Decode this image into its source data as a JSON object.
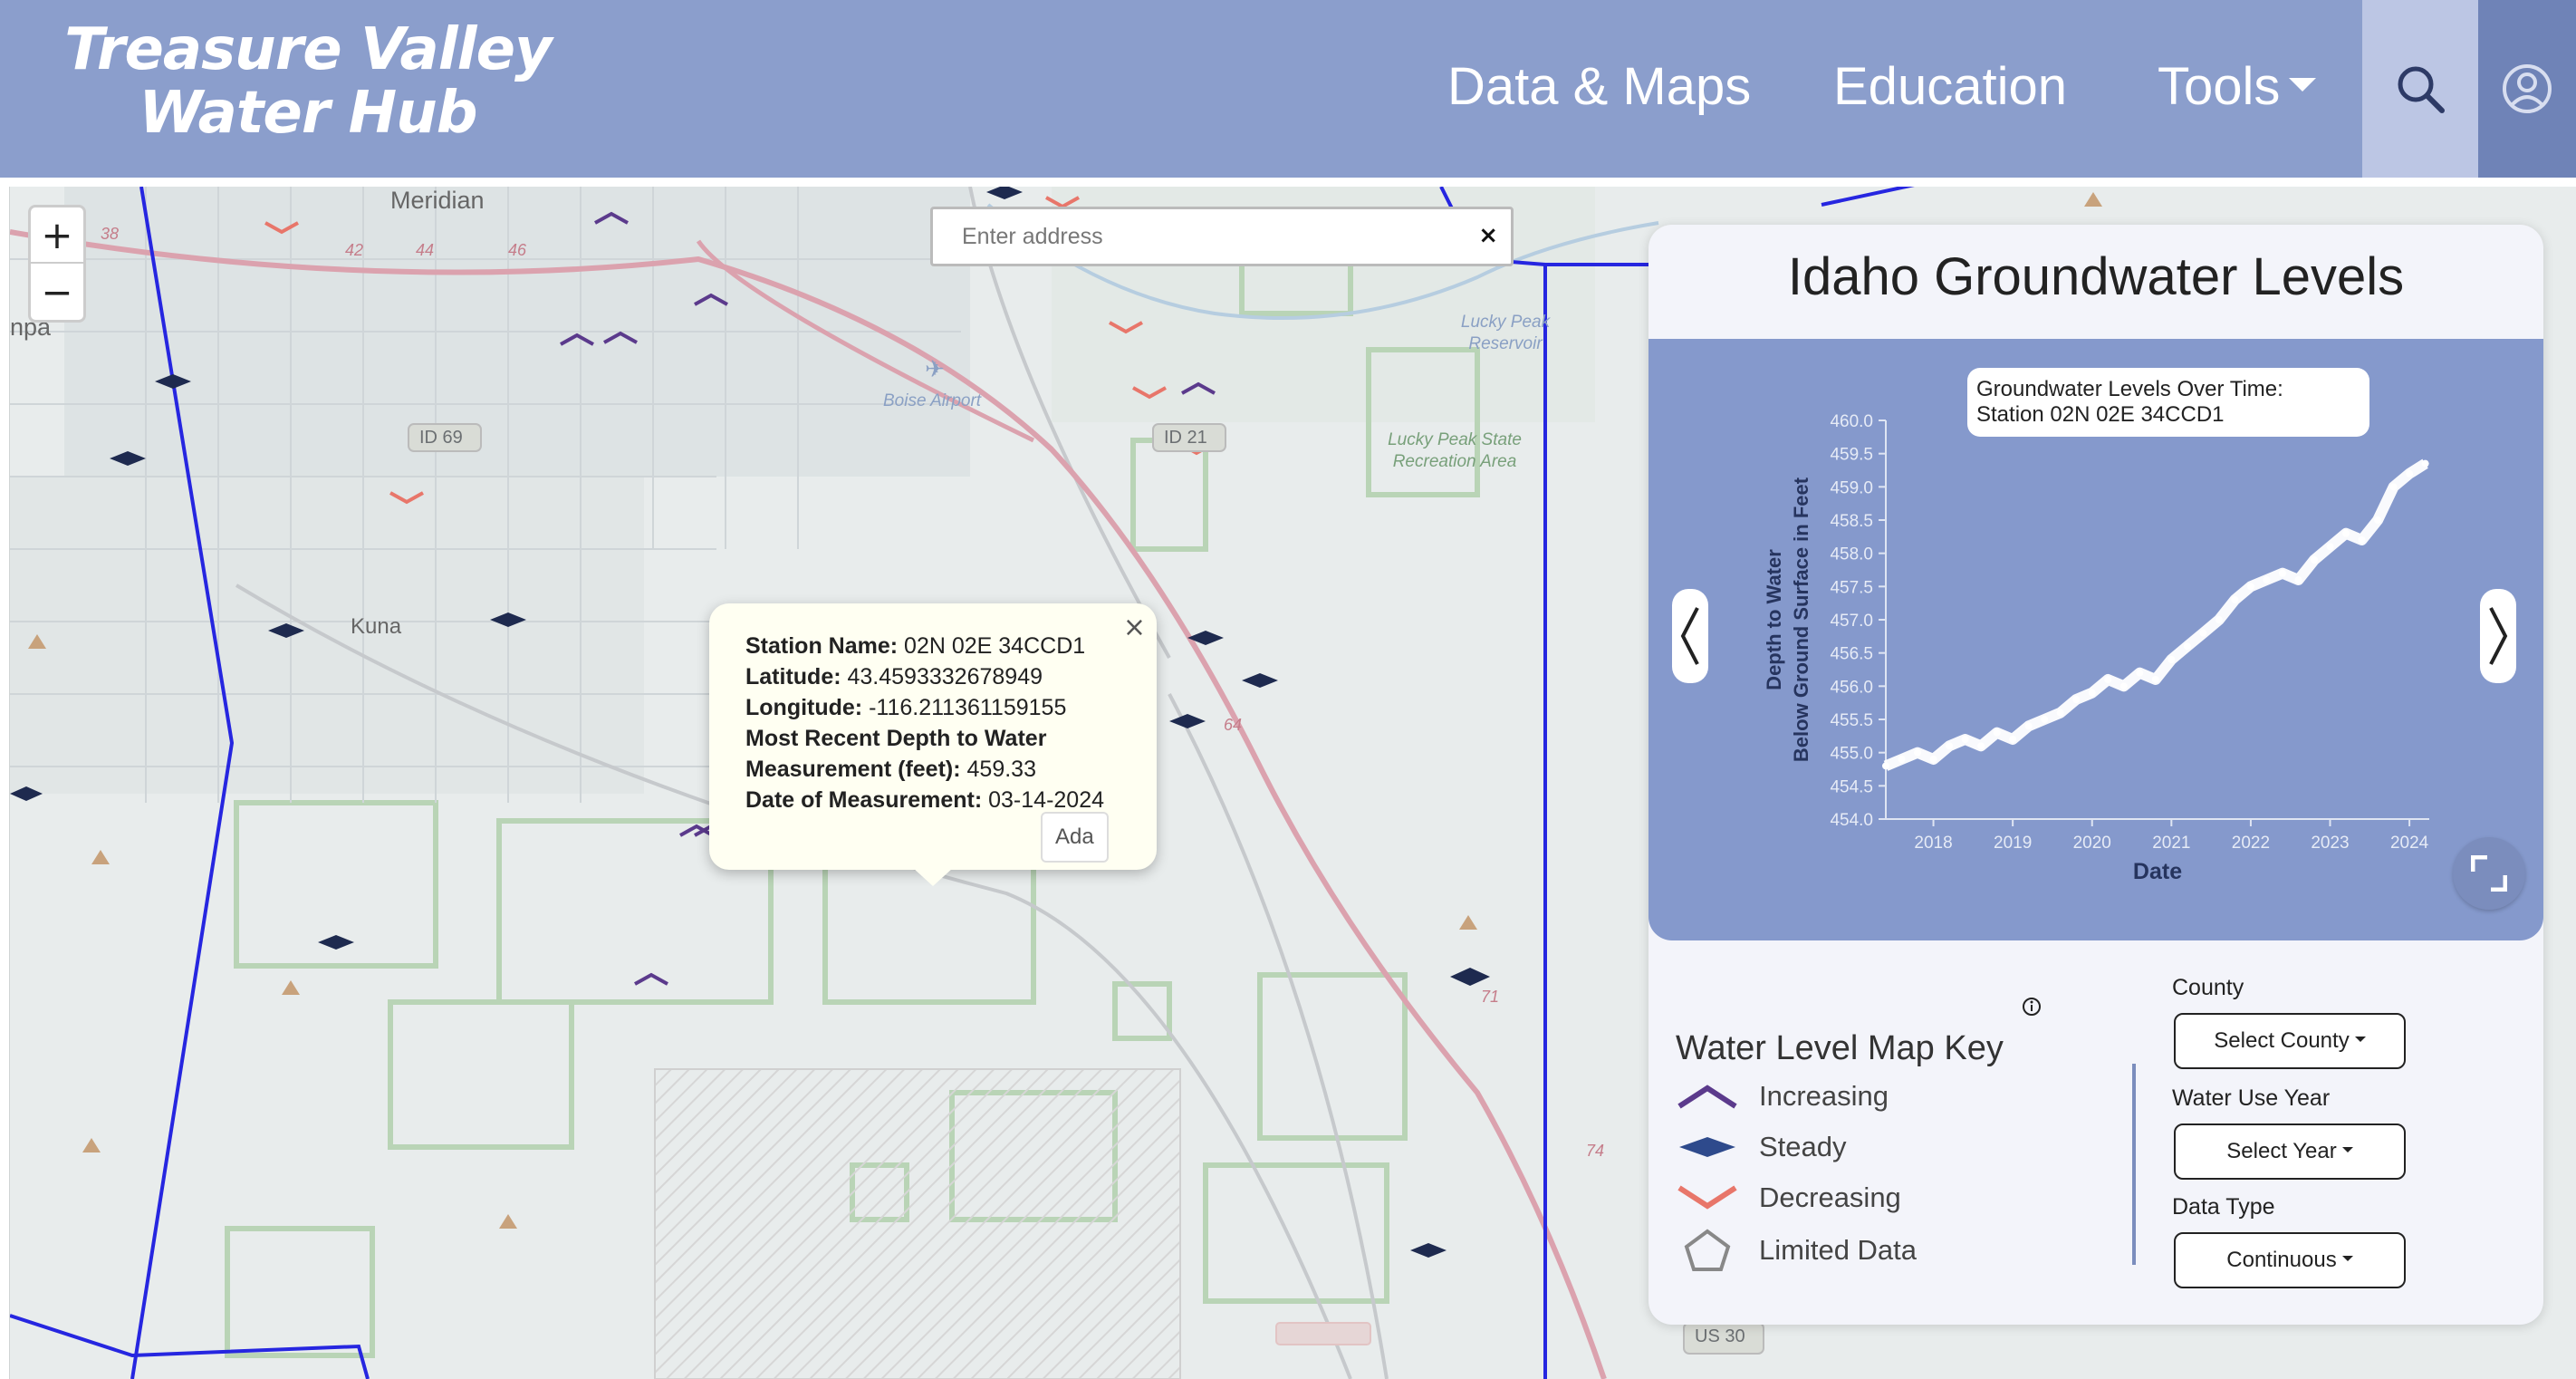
{
  "header": {
    "logo_line1": "Treasure Valley",
    "logo_line2": "Water Hub",
    "nav": [
      {
        "label": "Data & Maps"
      },
      {
        "label": "Education"
      },
      {
        "label": "Tools"
      }
    ],
    "bg_color": "#8b9ecc"
  },
  "map": {
    "zoom_in": "+",
    "zoom_out": "−",
    "address_placeholder": "Enter address",
    "address_clear": "×",
    "labels": {
      "meridian": "Meridian",
      "kuna": "Kuna",
      "npa": "npa",
      "boise_airport": "Boise Airport",
      "lucky_peak_reservoir": "Lucky Peak Reservoir",
      "lucky_peak_area": "Lucky Peak State Recreation Area",
      "id69": "ID 69",
      "id21": "ID 21",
      "us30": "US 30",
      "exit38": "38",
      "exit42": "42",
      "exit44": "44",
      "exit46": "46",
      "rt64": "64",
      "rt71": "71",
      "rt74": "74"
    },
    "popup": {
      "station_label": "Station Name:",
      "station_value": "02N 02E 34CCD1",
      "lat_label": "Latitude:",
      "lat_value": "43.4593332678949",
      "lon_label": "Longitude:",
      "lon_value": "-116.211361159155",
      "depth_label": "Most Recent Depth to Water Measurement (feet):",
      "depth_value": "459.33",
      "date_label": "Date of Measurement:",
      "date_value": "03-14-2024",
      "close": "×"
    },
    "county_label": "Ada"
  },
  "panel": {
    "title": "Idaho Groundwater Levels",
    "chart_title_line1": "Groundwater Levels Over Time:",
    "chart_title_line2": "Station 02N 02E 34CCD1",
    "key": {
      "title": "Water Level Map Key",
      "items": [
        {
          "label": "Increasing",
          "icon": "increasing-chevron-icon",
          "color": "#5b3a8c"
        },
        {
          "label": "Steady",
          "icon": "steady-diamond-icon",
          "color": "#2e4a8c"
        },
        {
          "label": "Decreasing",
          "icon": "decreasing-chevron-icon",
          "color": "#e8766a"
        },
        {
          "label": "Limited Data",
          "icon": "pentagon-icon",
          "color": "#888888"
        }
      ]
    },
    "filters": {
      "county_label": "County",
      "county_button": "Select County",
      "year_label": "Water Use Year",
      "year_button": "Select Year",
      "type_label": "Data Type",
      "type_button": "Continuous"
    }
  },
  "chart_data": {
    "type": "line",
    "title": "Groundwater Levels Over Time: Station 02N 02E 34CCD1",
    "xlabel": "Date",
    "ylabel": "Depth to Water Below Ground Surface in Feet",
    "x_ticks": [
      "2018",
      "2019",
      "2020",
      "2021",
      "2022",
      "2023",
      "2024"
    ],
    "y_ticks": [
      "454.0",
      "454.5",
      "455.0",
      "455.5",
      "456.0",
      "456.5",
      "457.0",
      "457.5",
      "458.0",
      "458.5",
      "459.0",
      "459.5",
      "460.0"
    ],
    "ylim": [
      454.0,
      460.0
    ],
    "xlim": [
      2017.4,
      2024.25
    ],
    "line_color": "#ffffff",
    "x": [
      2017.4,
      2017.6,
      2017.8,
      2018.0,
      2018.2,
      2018.4,
      2018.6,
      2018.8,
      2019.0,
      2019.2,
      2019.4,
      2019.6,
      2019.8,
      2020.0,
      2020.2,
      2020.4,
      2020.6,
      2020.8,
      2021.0,
      2021.2,
      2021.4,
      2021.6,
      2021.8,
      2022.0,
      2022.2,
      2022.4,
      2022.6,
      2022.8,
      2023.0,
      2023.2,
      2023.4,
      2023.6,
      2023.8,
      2024.0,
      2024.2
    ],
    "y": [
      454.8,
      454.9,
      455.0,
      454.9,
      455.1,
      455.2,
      455.1,
      455.3,
      455.2,
      455.4,
      455.5,
      455.6,
      455.8,
      455.9,
      456.1,
      456.0,
      456.2,
      456.1,
      456.4,
      456.6,
      456.8,
      457.0,
      457.3,
      457.5,
      457.6,
      457.7,
      457.6,
      457.9,
      458.1,
      458.3,
      458.2,
      458.5,
      459.0,
      459.2,
      459.35
    ]
  }
}
